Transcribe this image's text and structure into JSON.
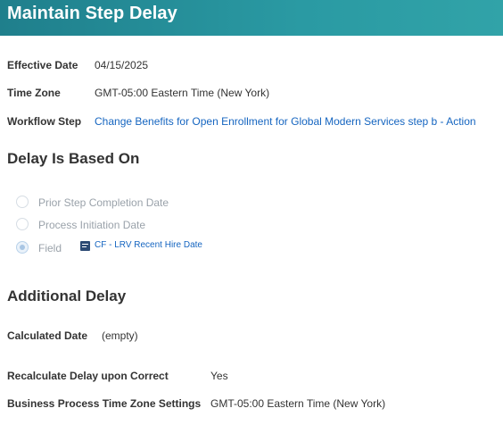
{
  "header": {
    "title": "Maintain Step Delay"
  },
  "details": {
    "effective_date_label": "Effective Date",
    "effective_date_value": "04/15/2025",
    "time_zone_label": "Time Zone",
    "time_zone_value": "GMT-05:00 Eastern Time (New York)",
    "workflow_step_label": "Workflow Step",
    "workflow_step_value": "Change Benefits for Open Enrollment for Global Modern Services step b - Action"
  },
  "delay_based_on": {
    "title": "Delay Is Based On",
    "options": [
      {
        "label": "Prior Step Completion Date",
        "selected": false
      },
      {
        "label": "Process Initiation Date",
        "selected": false
      },
      {
        "label": "Field",
        "selected": true
      }
    ],
    "field_value": "CF - LRV Recent Hire Date",
    "field_icon": "field-prompt-icon"
  },
  "additional_delay": {
    "title": "Additional Delay",
    "calculated_date_label": "Calculated Date",
    "calculated_date_value": "(empty)",
    "recalculate_label": "Recalculate Delay upon Correct",
    "recalculate_value": "Yes",
    "bp_timezone_label": "Business Process Time Zone Settings",
    "bp_timezone_value": "GMT-05:00 Eastern Time (New York)"
  },
  "colors": {
    "header": "#2a9aa3",
    "link": "#1565c0",
    "disabled_text": "#9aa2aa"
  }
}
